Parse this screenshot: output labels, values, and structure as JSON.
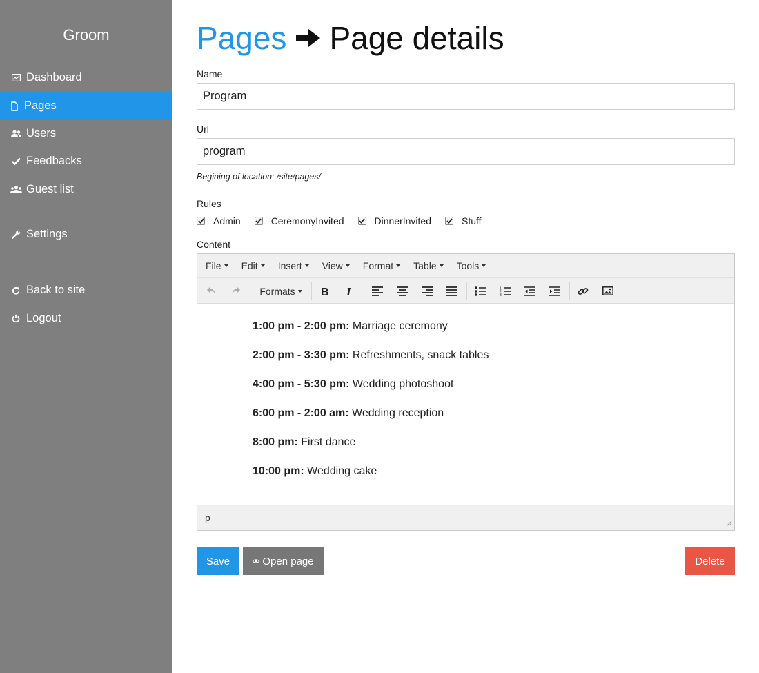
{
  "app": {
    "brand": "Groom"
  },
  "sidebar": {
    "items": [
      {
        "label": "Dashboard",
        "icon": "chart-icon"
      },
      {
        "label": "Pages",
        "icon": "page-icon",
        "active": true
      },
      {
        "label": "Users",
        "icon": "users-icon"
      },
      {
        "label": "Feedbacks",
        "icon": "check-icon"
      },
      {
        "label": "Guest list",
        "icon": "group-icon"
      },
      {
        "label": "Settings",
        "icon": "wrench-icon"
      }
    ],
    "bottom": [
      {
        "label": "Back to site",
        "icon": "refresh-icon"
      },
      {
        "label": "Logout",
        "icon": "power-icon"
      }
    ]
  },
  "header": {
    "crumb": "Pages",
    "current": "Page details",
    "arrow_icon": "arrow-right-icon"
  },
  "form": {
    "name_label": "Name",
    "name_value": "Program",
    "url_label": "Url",
    "url_value": "program",
    "url_hint": "Begining of location: /site/pages/",
    "rules_label": "Rules",
    "rules": [
      {
        "label": "Admin",
        "checked": true
      },
      {
        "label": "CeremonyInvited",
        "checked": true
      },
      {
        "label": "DinnerInvited",
        "checked": true
      },
      {
        "label": "Stuff",
        "checked": true
      }
    ],
    "content_label": "Content"
  },
  "editor": {
    "menu": [
      "File",
      "Edit",
      "Insert",
      "View",
      "Format",
      "Table",
      "Tools"
    ],
    "formats_label": "Formats",
    "toolbar_icons": [
      "undo-icon",
      "redo-icon",
      "bold-icon",
      "italic-icon",
      "align-left-icon",
      "align-center-icon",
      "align-right-icon",
      "align-justify-icon",
      "bullet-list-icon",
      "numbered-list-icon",
      "outdent-icon",
      "indent-icon",
      "link-icon",
      "image-icon"
    ],
    "lines": [
      {
        "time": "1:00 pm - 2:00 pm:",
        "text": " Marriage ceremony"
      },
      {
        "time": "2:00 pm - 3:30 pm:",
        "text": " Refreshments, snack tables"
      },
      {
        "time": "4:00 pm - 5:30 pm:",
        "text": " Wedding photoshoot"
      },
      {
        "time": "6:00 pm - 2:00 am:",
        "text": " Wedding reception"
      },
      {
        "time": "8:00 pm:",
        "text": " First dance"
      },
      {
        "time": "10:00 pm:",
        "text": " Wedding cake"
      }
    ],
    "status_path": "p"
  },
  "actions": {
    "save_label": "Save",
    "open_label": "Open page",
    "delete_label": "Delete"
  },
  "colors": {
    "sidebar_bg": "#7f7f7f",
    "accent": "#2196e9",
    "danger": "#ea5544",
    "secondary": "#777777"
  }
}
